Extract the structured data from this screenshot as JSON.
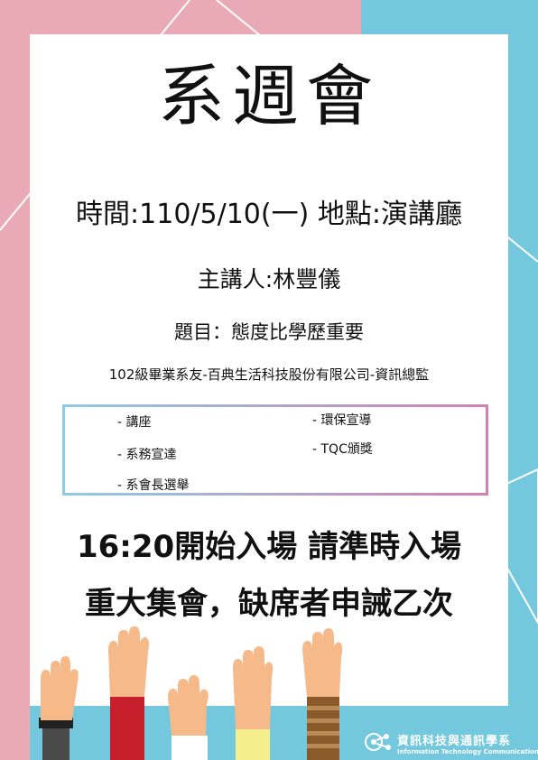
{
  "poster": {
    "title": "系週會",
    "time_place": "時間:110/5/10(一)  地點:演講廳",
    "speaker": "主講人:林豐儀",
    "topic": "題目：態度比學歷重要",
    "speaker_bio": "102級畢業系友-百典生活科技股份有限公司-資訊總監",
    "agenda_left": [
      "- 講座",
      "- 系務宣達",
      "- 系會長選舉"
    ],
    "agenda_right": [
      "- 環保宣導",
      "- TQC頒獎"
    ],
    "entry_notice": "16:20開始入場  請準時入場",
    "attendance_notice": "重大集會，缺席者申誡乙次"
  },
  "logo": {
    "name_zh": "資訊科技與通訊學系",
    "name_en": "Information Technology Communication"
  },
  "colors": {
    "pink": "#e9aab5",
    "cyan": "#74c8de",
    "border_start": "#8fcbe3",
    "border_end": "#d37fb3"
  }
}
